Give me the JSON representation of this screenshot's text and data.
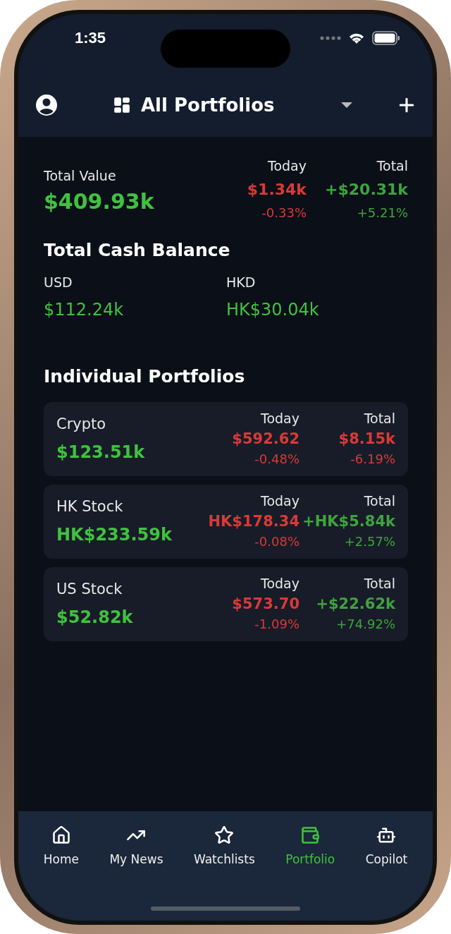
{
  "status_bar": {
    "time": "1:35"
  },
  "header": {
    "title": "All Portfolios"
  },
  "summary": {
    "label": "Total Value",
    "value": "$409.93k",
    "changes": [
      {
        "label": "Today",
        "amount": "$1.34k",
        "percent": "-0.33%",
        "color": "#d93a37"
      },
      {
        "label": "Total",
        "amount": "+$20.31k",
        "percent": "+5.21%",
        "color": "#3fa33f"
      }
    ]
  },
  "cash": {
    "title": "Total Cash Balance",
    "balances": [
      {
        "currency": "USD",
        "amount": "$112.24k"
      },
      {
        "currency": "HKD",
        "amount": "HK$30.04k"
      }
    ]
  },
  "portfolios": {
    "title": "Individual Portfolios",
    "items": [
      {
        "name": "Crypto",
        "value": "$123.51k",
        "changes": [
          {
            "label": "Today",
            "amount": "$592.62",
            "percent": "-0.48%",
            "color": "#d93a37"
          },
          {
            "label": "Total",
            "amount": "$8.15k",
            "percent": "-6.19%",
            "color": "#d93a37"
          }
        ]
      },
      {
        "name": "HK Stock",
        "value": "HK$233.59k",
        "changes": [
          {
            "label": "Today",
            "amount": "HK$178.34",
            "percent": "-0.08%",
            "color": "#d93a37"
          },
          {
            "label": "Total",
            "amount": "+HK$5.84k",
            "percent": "+2.57%",
            "color": "#3fa33f"
          }
        ]
      },
      {
        "name": "US Stock",
        "value": "$52.82k",
        "changes": [
          {
            "label": "Today",
            "amount": "$573.70",
            "percent": "-1.09%",
            "color": "#d93a37"
          },
          {
            "label": "Total",
            "amount": "+$22.62k",
            "percent": "+74.92%",
            "color": "#3fa33f"
          }
        ]
      }
    ]
  },
  "tab_bar": [
    {
      "label": "Home",
      "selected": false
    },
    {
      "label": "My News",
      "selected": false
    },
    {
      "label": "Watchlists",
      "selected": false
    },
    {
      "label": "Portfolio",
      "selected": true
    },
    {
      "label": "Copilot",
      "selected": false
    }
  ]
}
